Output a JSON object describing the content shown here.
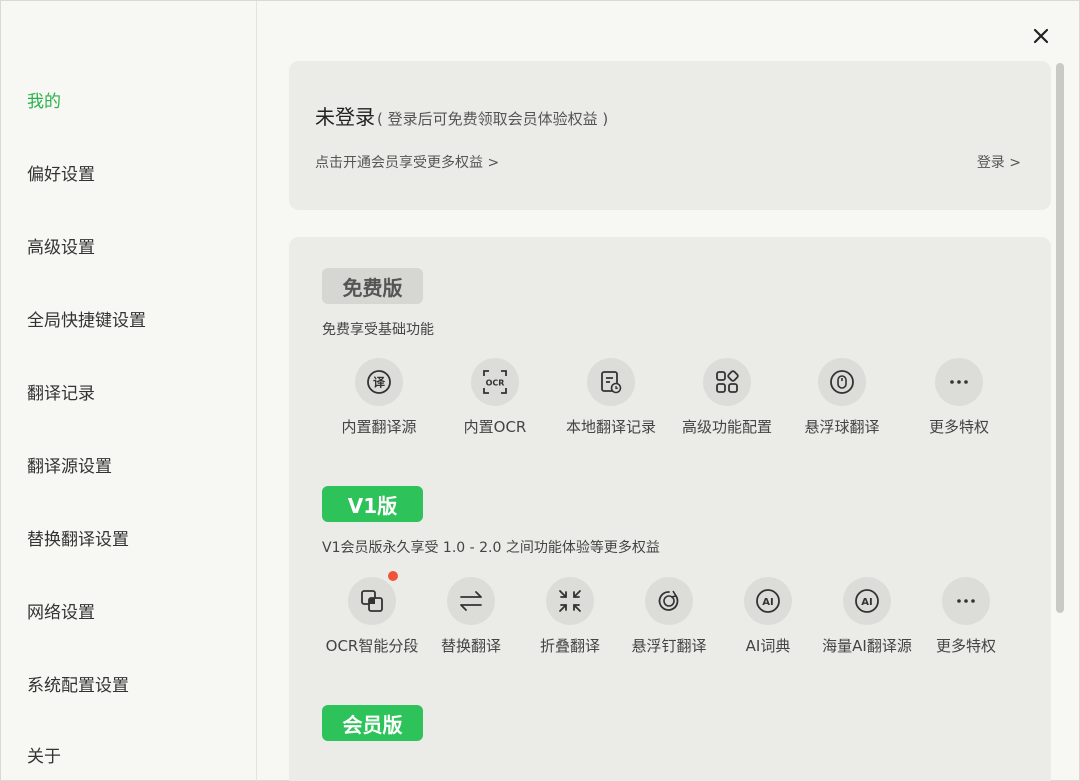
{
  "sidebar": {
    "items": [
      {
        "label": "我的",
        "active": true
      },
      {
        "label": "偏好设置"
      },
      {
        "label": "高级设置"
      },
      {
        "label": "全局快捷键设置"
      },
      {
        "label": "翻译记录"
      },
      {
        "label": "翻译源设置"
      },
      {
        "label": "替换翻译设置"
      },
      {
        "label": "网络设置"
      },
      {
        "label": "系统配置设置"
      },
      {
        "label": "关于"
      }
    ]
  },
  "login": {
    "status": "未登录",
    "hint": "( 登录后可免费领取会员体验权益 )",
    "member_link": "点击开通会员享受更多权益 >",
    "login_link": "登录 >"
  },
  "plans": [
    {
      "badge": "免费版",
      "desc": "免费享受基础功能",
      "features": [
        {
          "label": "内置翻译源",
          "icon": "translate-icon"
        },
        {
          "label": "内置OCR",
          "icon": "ocr-icon"
        },
        {
          "label": "本地翻译记录",
          "icon": "history-icon"
        },
        {
          "label": "高级功能配置",
          "icon": "grid-icon"
        },
        {
          "label": "悬浮球翻译",
          "icon": "mouse-icon"
        },
        {
          "label": "更多特权",
          "icon": "more-icon"
        }
      ]
    },
    {
      "badge": "V1版",
      "desc": "V1会员版永久享受 1.0 - 2.0 之间功能体验等更多权益",
      "features": [
        {
          "label": "OCR智能分段",
          "icon": "layers-icon",
          "dot": true
        },
        {
          "label": "替换翻译",
          "icon": "swap-icon"
        },
        {
          "label": "折叠翻译",
          "icon": "collapse-icon"
        },
        {
          "label": "悬浮钉翻译",
          "icon": "pin-icon"
        },
        {
          "label": "AI词典",
          "icon": "ai-icon"
        },
        {
          "label": "海量AI翻译源",
          "icon": "ai-icon"
        },
        {
          "label": "更多特权",
          "icon": "more-icon"
        }
      ]
    },
    {
      "badge": "会员版"
    }
  ],
  "colors": {
    "accent": "#2dc25a",
    "active_text": "#2bb24c",
    "notification_dot": "#f0533a"
  }
}
